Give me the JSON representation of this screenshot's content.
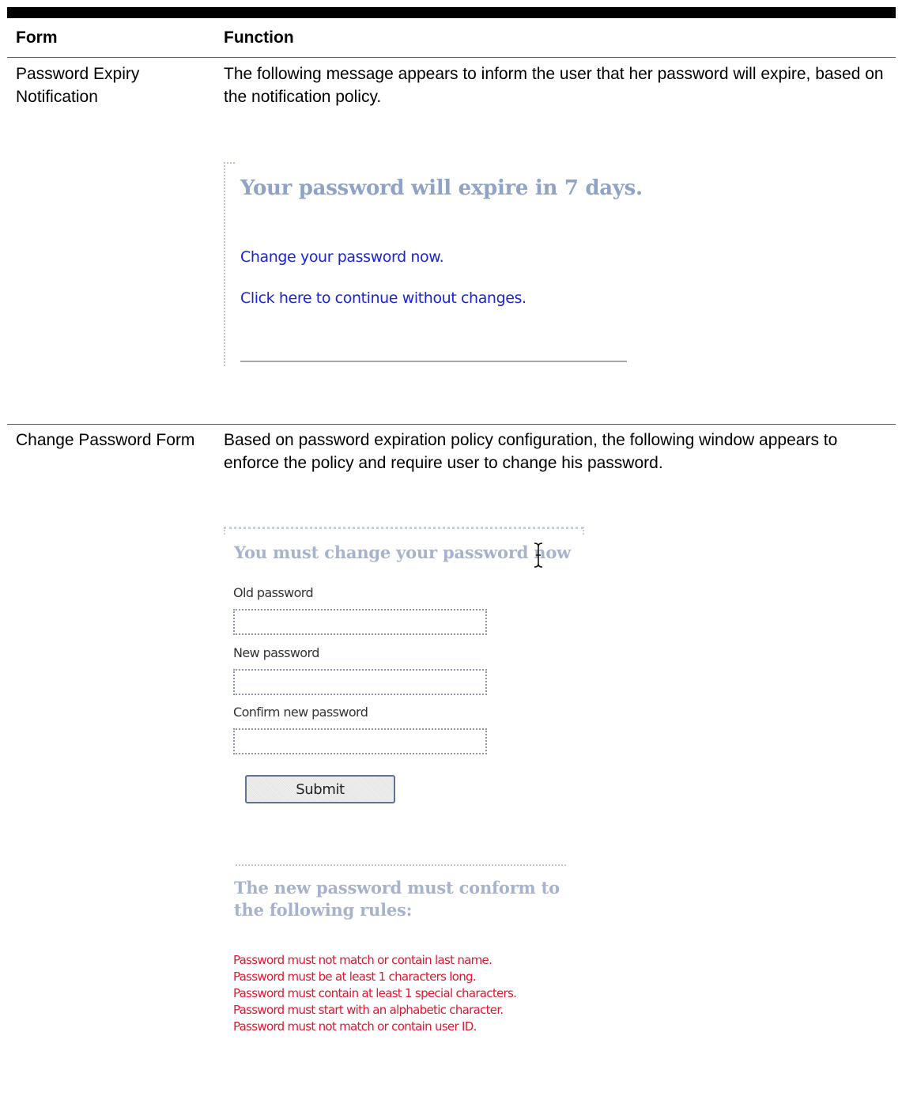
{
  "table": {
    "headers": {
      "form": "Form",
      "function": "Function"
    },
    "rows": [
      {
        "form": "Password Expiry Notification",
        "function": "The following message appears to inform the user that her password will expire, based on the notification policy."
      },
      {
        "form": "Change Password Form",
        "function": "Based on password expiration policy configuration, the following window appears to enforce the policy and require user to change his password."
      }
    ]
  },
  "expiry_notice": {
    "title": "Your password will expire in 7 days.",
    "change_link": "Change your password now.",
    "continue_link": "Click here to continue without changes."
  },
  "change_password": {
    "title": "You must change your password now",
    "old_password_label": "Old password",
    "old_password_value": "",
    "new_password_label": "New password",
    "new_password_value": "",
    "confirm_password_label": "Confirm new password",
    "confirm_password_value": "",
    "submit_label": "Submit",
    "rules_title": "The new password must conform to the following rules:",
    "rules": [
      "Password must not match or contain last name.",
      "Password must be at least 1 characters long.",
      "Password must contain at least 1 special characters.",
      "Password must start with an alphabetic character.",
      "Password must not match or contain user ID."
    ]
  },
  "colors": {
    "heading_blue": "#8fa3c4",
    "link_blue": "#1a24d6",
    "rule_red": "#e0182e"
  }
}
